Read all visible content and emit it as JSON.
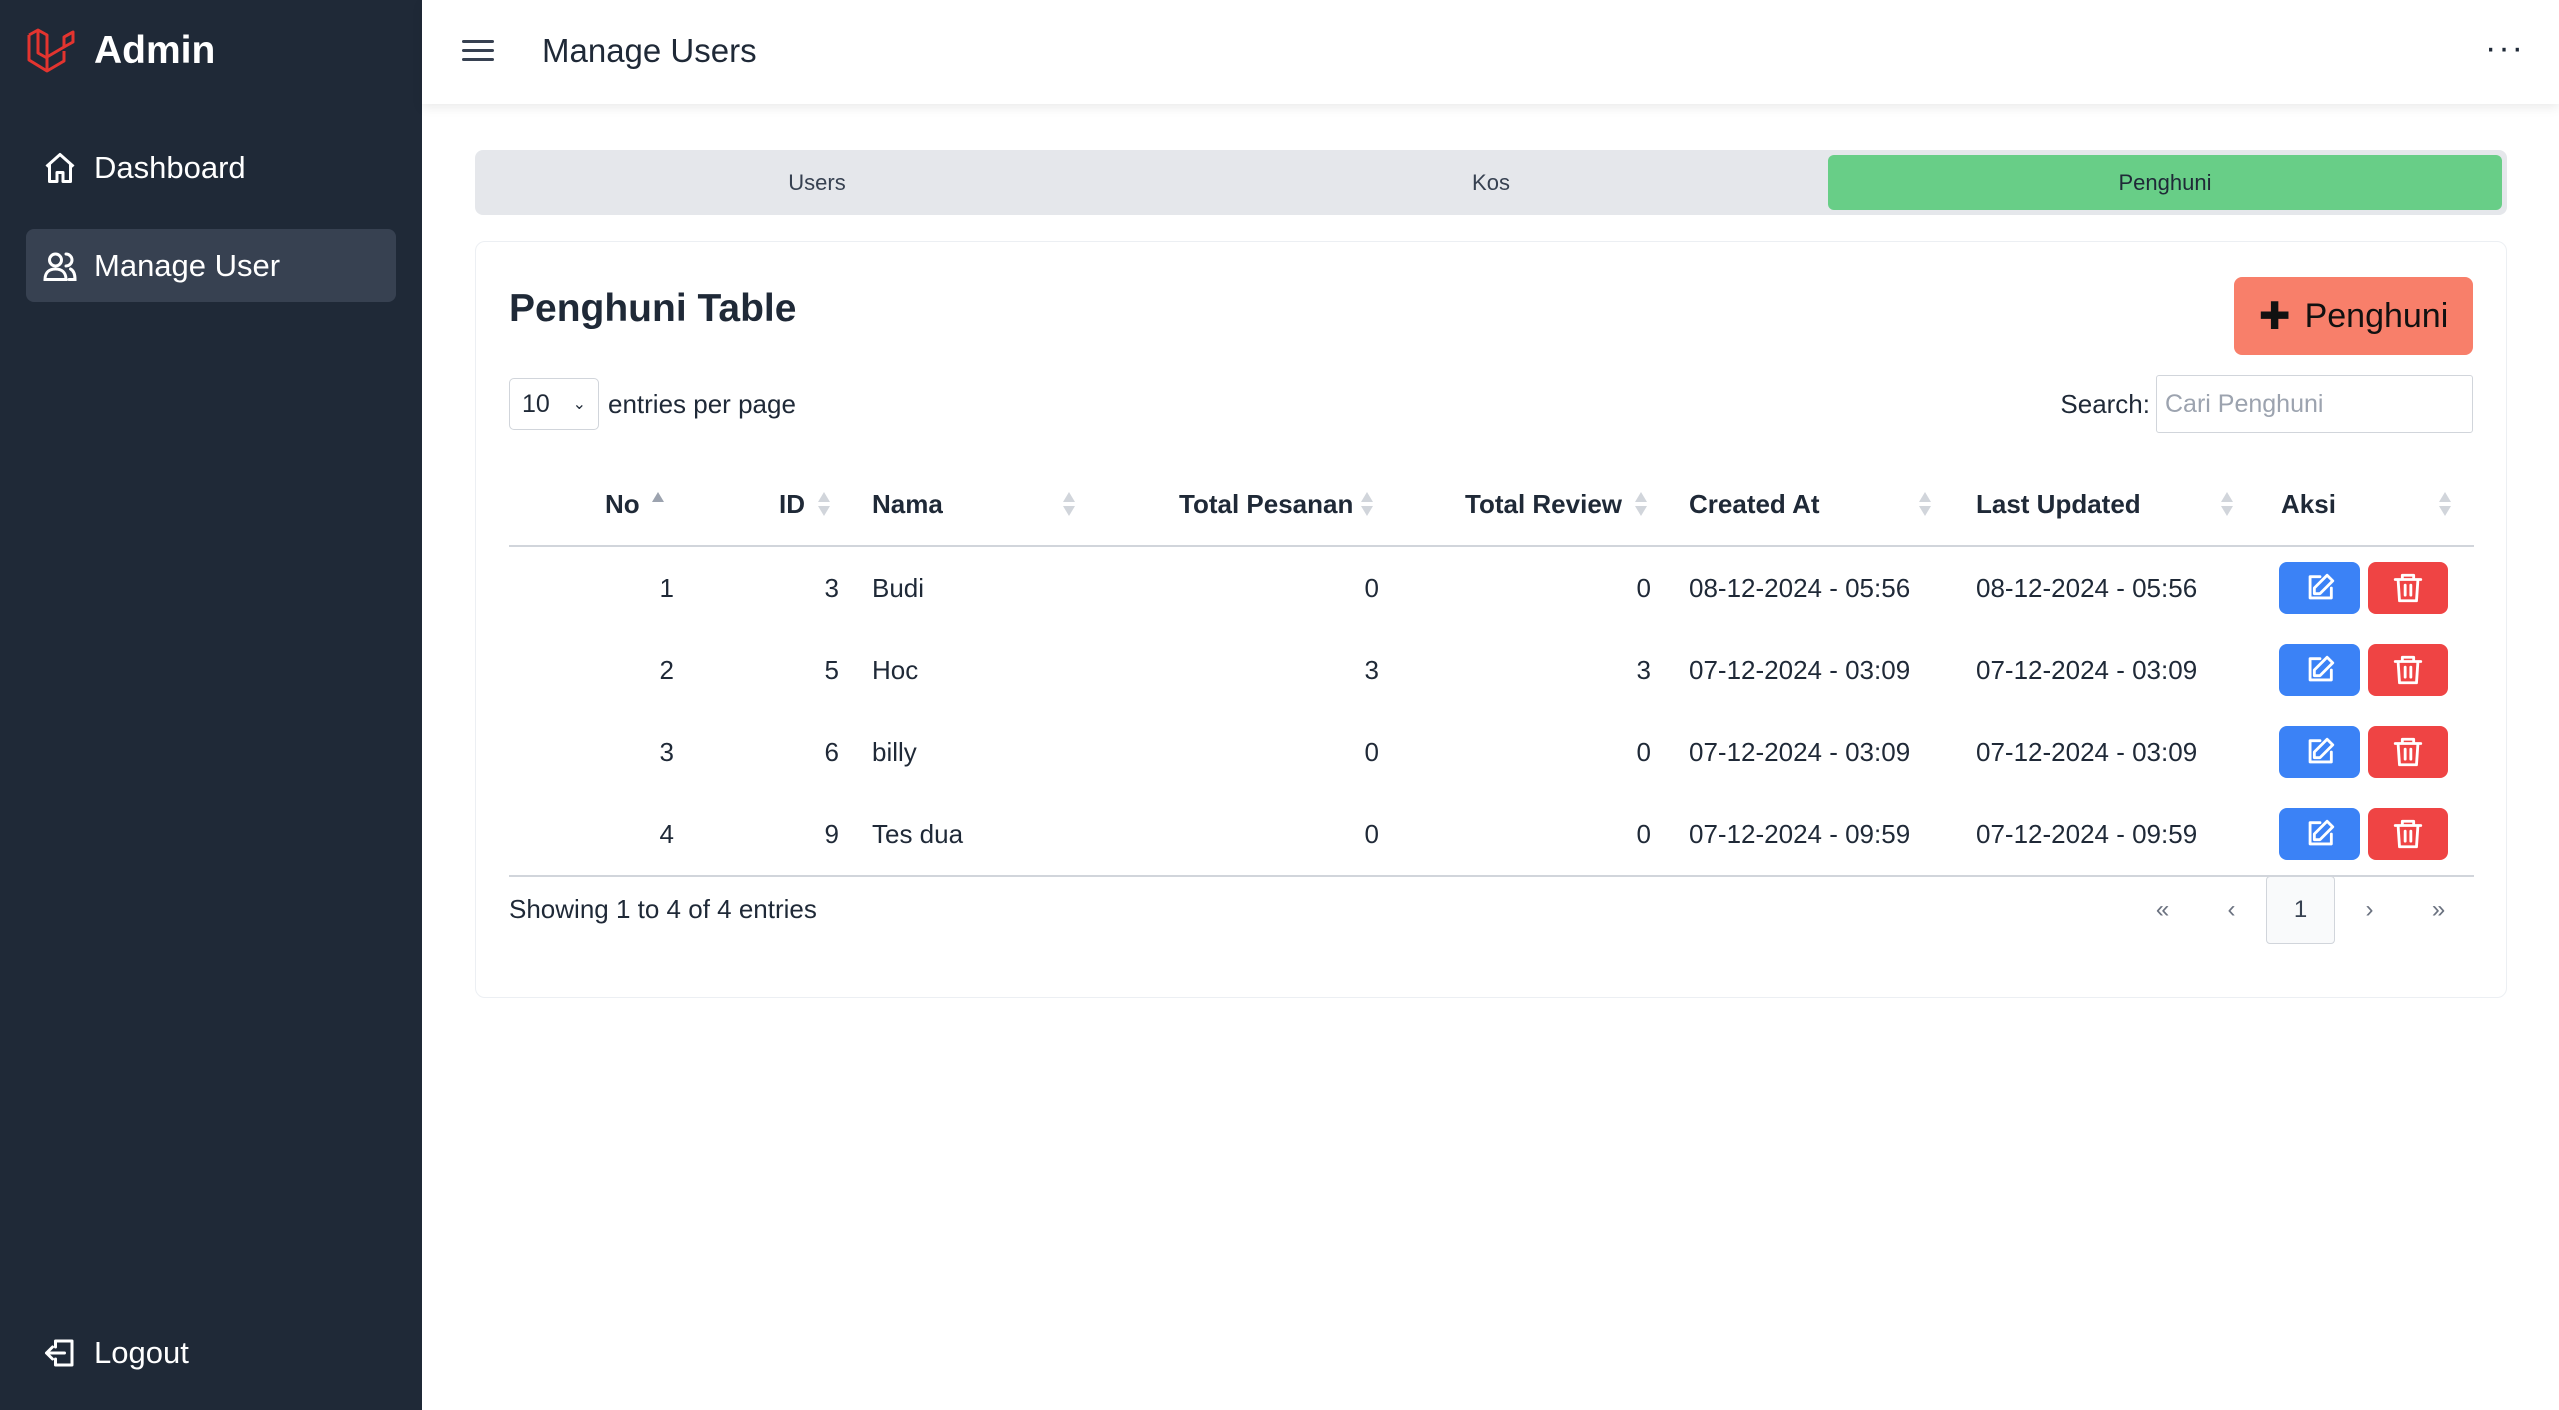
{
  "sidebar": {
    "brand": "Admin",
    "items": [
      {
        "label": "Dashboard",
        "icon": "home-icon"
      },
      {
        "label": "Manage User",
        "icon": "users-icon",
        "active": true
      }
    ],
    "logout": "Logout"
  },
  "header": {
    "title": "Manage Users",
    "menu": "···"
  },
  "tabs": [
    "Users",
    "Kos",
    "Penghuni"
  ],
  "active_tab": "Penghuni",
  "card": {
    "title": "Penghuni Table",
    "add_button": "Penghuni",
    "entries_value": "10",
    "entries_label": "entries per page",
    "search_label": "Search:",
    "search_placeholder": "Cari Penghuni"
  },
  "table": {
    "columns": [
      "No",
      "ID",
      "Nama",
      "Total Pesanan",
      "Total Review",
      "Created At",
      "Last Updated",
      "Aksi"
    ],
    "rows": [
      {
        "no": "1",
        "id": "3",
        "nama": "Budi",
        "pesanan": "0",
        "review": "0",
        "created": "08-12-2024 - 05:56",
        "updated": "08-12-2024 - 05:56"
      },
      {
        "no": "2",
        "id": "5",
        "nama": "Hoc",
        "pesanan": "3",
        "review": "3",
        "created": "07-12-2024 - 03:09",
        "updated": "07-12-2024 - 03:09"
      },
      {
        "no": "3",
        "id": "6",
        "nama": "billy",
        "pesanan": "0",
        "review": "0",
        "created": "07-12-2024 - 03:09",
        "updated": "07-12-2024 - 03:09"
      },
      {
        "no": "4",
        "id": "9",
        "nama": "Tes dua",
        "pesanan": "0",
        "review": "0",
        "created": "07-12-2024 - 09:59",
        "updated": "07-12-2024 - 09:59"
      }
    ]
  },
  "footer": {
    "showing": "Showing 1 to 4 of 4 entries",
    "pager": [
      "«",
      "‹",
      "1",
      "›",
      "»"
    ]
  },
  "colors": {
    "sidebar": "#1f2937",
    "active_tab": "#68ce87",
    "add_button": "#f87f6a",
    "edit": "#3b82f6",
    "delete": "#ef4444"
  }
}
